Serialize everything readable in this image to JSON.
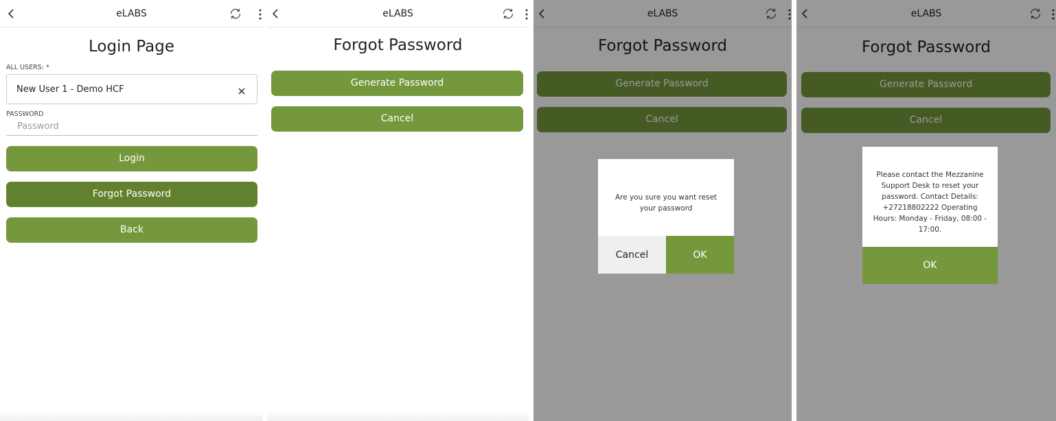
{
  "app": {
    "title": "eLABS"
  },
  "login": {
    "heading": "Login Page",
    "all_users_label": "ALL USERS: *",
    "selected_user": "New User 1 - Demo HCF",
    "password_label": "PASSWORD",
    "password_placeholder": "Password",
    "password_value": "",
    "login_label": "Login",
    "forgot_label": "Forgot Password",
    "back_label": "Back"
  },
  "forgot": {
    "heading": "Forgot Password",
    "generate_label": "Generate Password",
    "cancel_label": "Cancel"
  },
  "confirm_dialog": {
    "message": "Are you sure you want reset your password",
    "cancel_label": "Cancel",
    "ok_label": "OK"
  },
  "info_dialog": {
    "message": "Please contact the Mezzanine Support Desk to reset your password. Contact Details: +27218802222 Operating Hours: Monday - Friday, 08:00 - 17:00.",
    "ok_label": "OK"
  },
  "icons": {
    "back": "chevron-left-icon",
    "sync": "sync-icon",
    "more": "more-vertical-icon",
    "clear": "close-icon"
  },
  "colors": {
    "accent": "#74983b",
    "accent_dark": "#62812f",
    "overlay": "#999999"
  }
}
